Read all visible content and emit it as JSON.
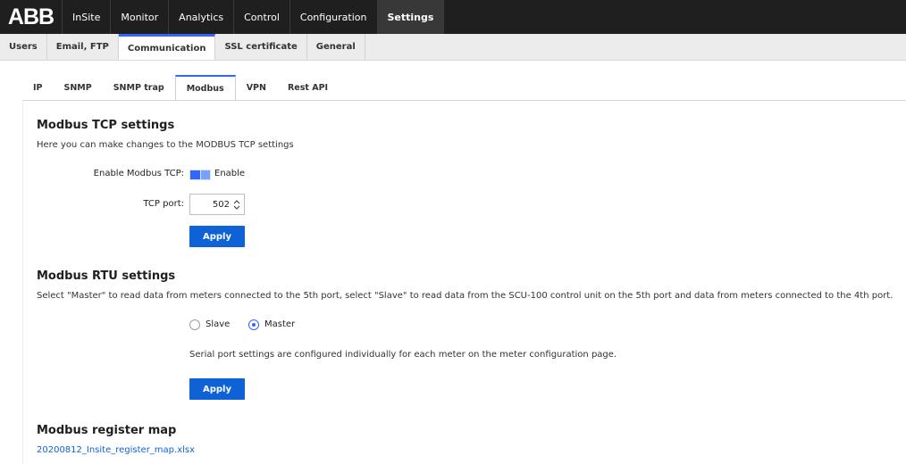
{
  "logo": "ABB",
  "topnav": {
    "app_name": "InSite",
    "items": [
      {
        "label": "Monitor"
      },
      {
        "label": "Analytics"
      },
      {
        "label": "Control"
      },
      {
        "label": "Configuration"
      },
      {
        "label": "Settings"
      }
    ],
    "active": "Settings"
  },
  "subnav": {
    "items": [
      {
        "label": "Users"
      },
      {
        "label": "Email, FTP"
      },
      {
        "label": "Communication"
      },
      {
        "label": "SSL certificate"
      },
      {
        "label": "General"
      }
    ],
    "active": "Communication"
  },
  "tabs": {
    "items": [
      {
        "label": "IP"
      },
      {
        "label": "SNMP"
      },
      {
        "label": "SNMP trap"
      },
      {
        "label": "Modbus"
      },
      {
        "label": "VPN"
      },
      {
        "label": "Rest API"
      }
    ],
    "active": "Modbus"
  },
  "tcp": {
    "title": "Modbus TCP settings",
    "description": "Here you can make changes to the MODBUS TCP settings",
    "enable_label": "Enable Modbus TCP:",
    "enable_text": "Enable",
    "enabled": true,
    "port_label": "TCP port:",
    "port_value": "502",
    "apply_label": "Apply"
  },
  "rtu": {
    "title": "Modbus RTU settings",
    "description": "Select \"Master\" to read data from meters connected to the 5th port, select \"Slave\" to read data from the SCU-100 control unit on the 5th port and data from meters connected to the 4th port.",
    "options": [
      {
        "label": "Slave",
        "checked": false
      },
      {
        "label": "Master",
        "checked": true
      }
    ],
    "note": "Serial port settings are configured individually for each meter on the meter configuration page.",
    "apply_label": "Apply"
  },
  "register_map": {
    "title": "Modbus register map",
    "file_link": "20200812_Insite_register_map.xlsx"
  },
  "colors": {
    "accent": "#3366ff",
    "button": "#0f62d6",
    "topbar": "#1f1f1f"
  }
}
